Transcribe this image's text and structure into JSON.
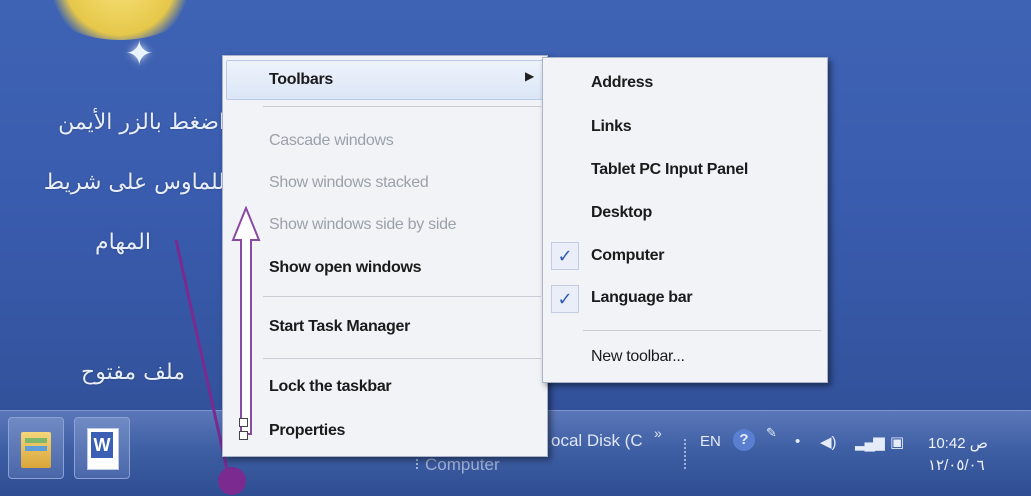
{
  "annotations": {
    "line1": "اضغط بالزر الأيمن",
    "line2": "للماوس على شريط",
    "line3": "المهام",
    "open_file": "ملف مفتوح"
  },
  "context_menu": {
    "items": [
      {
        "label": "Toolbars",
        "enabled": true,
        "has_submenu": true
      },
      {
        "label": "Cascade windows",
        "enabled": false
      },
      {
        "label": "Show windows stacked",
        "enabled": false
      },
      {
        "label": "Show windows side by side",
        "enabled": false
      },
      {
        "label": "Show open windows",
        "enabled": true
      },
      {
        "label": "Start Task Manager",
        "enabled": true
      },
      {
        "label": "Lock the taskbar",
        "enabled": true
      },
      {
        "label": "Properties",
        "enabled": true
      }
    ]
  },
  "toolbars_submenu": {
    "items": [
      {
        "label": "Address",
        "checked": false
      },
      {
        "label": "Links",
        "checked": false
      },
      {
        "label": "Tablet PC Input Panel",
        "checked": false
      },
      {
        "label": "Desktop",
        "checked": false
      },
      {
        "label": "Computer",
        "checked": true
      },
      {
        "label": "Language bar",
        "checked": true
      },
      {
        "label": "New toolbar...",
        "checked": false
      }
    ],
    "check_mark": "✓"
  },
  "taskbar": {
    "computer_label": "Computer",
    "local_disk_label": "ocal Disk (C",
    "overflow_chevron": "»",
    "language": "EN",
    "help_icon": "?",
    "clock_time": "10:42",
    "clock_ampm": "ص",
    "clock_date": "١٢/٠٥/٠٦"
  },
  "colors": {
    "desktop": "#3a5cae",
    "menu_bg": "#f2f3f7",
    "disabled_text": "#9ba1aa",
    "check": "#2d58b5",
    "pointer_line": "#7b2a8f"
  }
}
